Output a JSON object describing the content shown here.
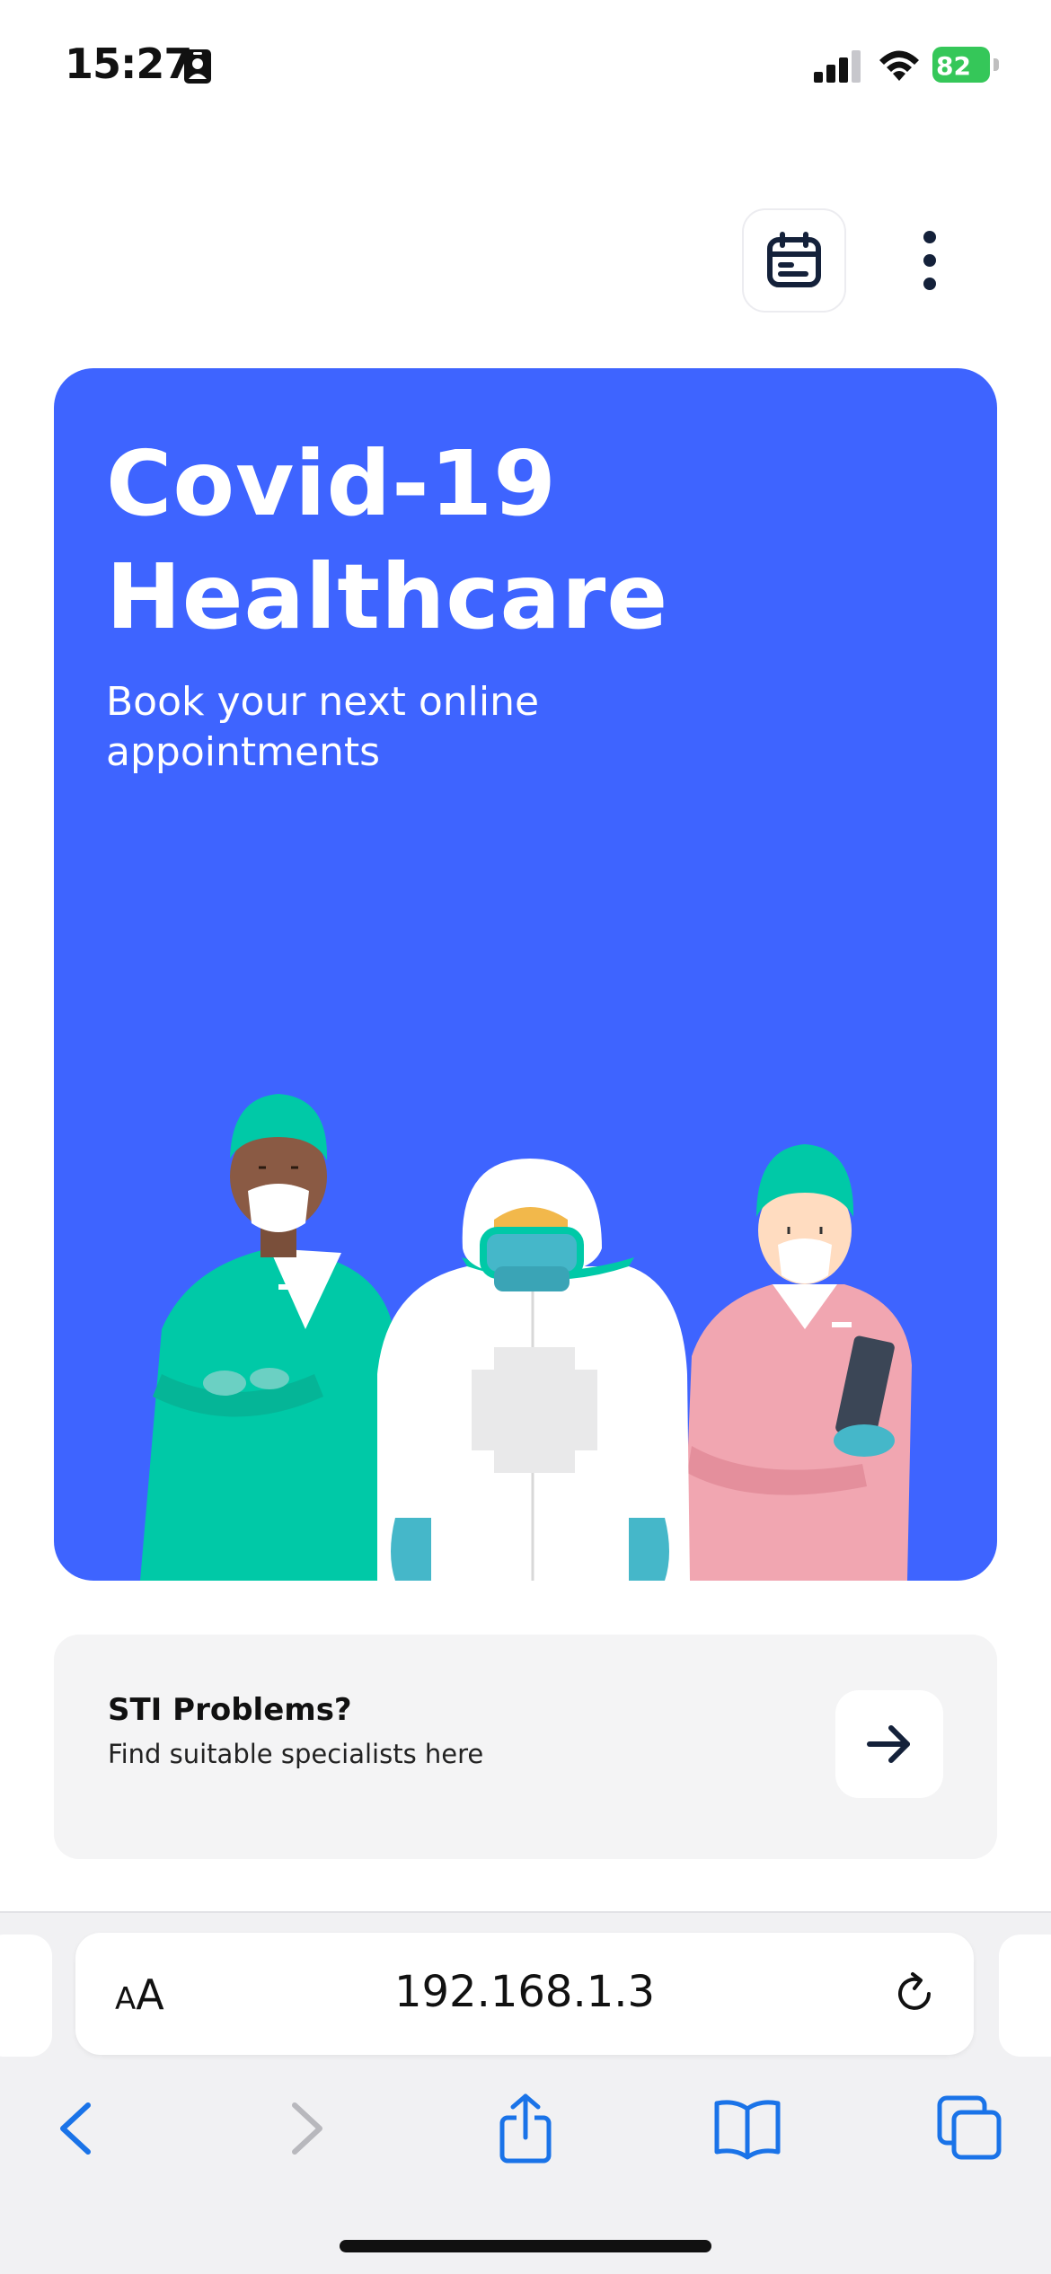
{
  "status_bar": {
    "time": "15:27",
    "battery_percent": "82",
    "icons": [
      "id-card-icon",
      "cellular-signal-icon",
      "wifi-icon",
      "battery-charging-icon"
    ]
  },
  "header": {
    "calendar_icon": "calendar-icon",
    "more_icon": "more-vertical-icon"
  },
  "hero": {
    "title_line1": "Covid-19",
    "title_line2": "Healthcare",
    "subtitle": "Book your next online appointments",
    "background_color": "#3e64ff"
  },
  "sti_card": {
    "title": "STI Problems?",
    "subtitle": "Find suitable specialists here",
    "arrow_icon": "arrow-right-icon"
  },
  "browser": {
    "aa_label_small": "A",
    "aa_label_large": "A",
    "url": "192.168.1.3",
    "toolbar": [
      "back-icon",
      "forward-icon",
      "share-icon",
      "bookmarks-icon",
      "tabs-icon"
    ],
    "accent_color": "#1a73e8"
  }
}
